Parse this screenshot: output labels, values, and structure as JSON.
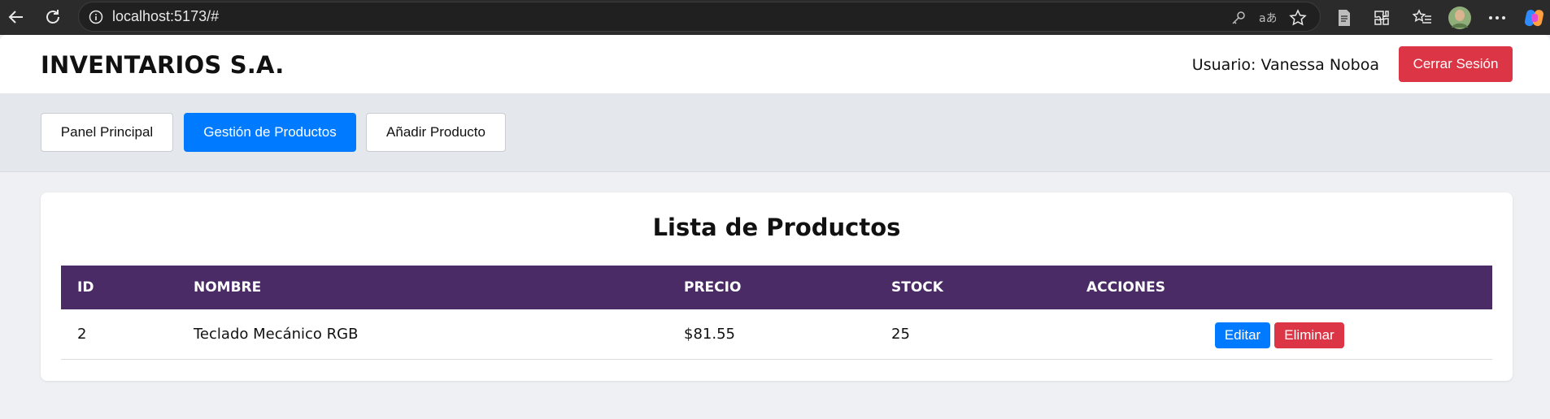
{
  "browser": {
    "url": "localhost:5173/#",
    "icons": [
      "back-icon",
      "reload-icon",
      "info-icon",
      "key-icon",
      "translate-icon",
      "favorite-star-icon",
      "reading-mode-icon",
      "extensions-icon",
      "favorites-list-icon",
      "profile-avatar",
      "more-options-icon",
      "copilot-icon"
    ]
  },
  "header": {
    "brand": "INVENTARIOS S.A.",
    "user_label": "Usuario: Vanessa Noboa",
    "logout_label": "Cerrar Sesión"
  },
  "nav": {
    "tabs": [
      {
        "label": "Panel Principal",
        "active": false
      },
      {
        "label": "Gestión de Productos",
        "active": true
      },
      {
        "label": "Añadir Producto",
        "active": false
      }
    ]
  },
  "products": {
    "title": "Lista de Productos",
    "columns": [
      "ID",
      "NOMBRE",
      "PRECIO",
      "STOCK",
      "ACCIONES"
    ],
    "rows": [
      {
        "id": "2",
        "nombre": "Teclado Mecánico RGB",
        "precio": "$81.55",
        "stock": "25"
      }
    ],
    "edit_label": "Editar",
    "delete_label": "Eliminar"
  },
  "colors": {
    "header_purple": "#4a2b66",
    "primary_blue": "#007bff",
    "danger_red": "#dc3545"
  }
}
